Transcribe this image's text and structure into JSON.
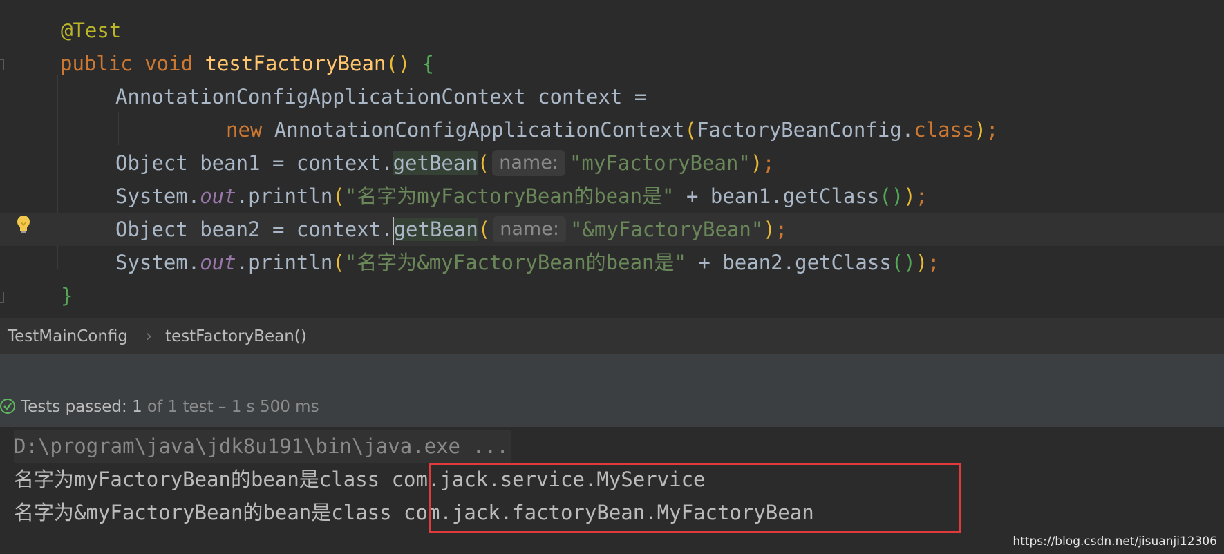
{
  "editor": {
    "annotation": "@Test",
    "method_kw": "public void ",
    "method_name": "testFactoryBean",
    "method_parens": "()",
    "open_brace": " {",
    "line3": "AnnotationConfigApplicationContext context =",
    "line4_kw": "new ",
    "line4_type": "AnnotationConfigApplicationContext",
    "line4_paren_open": "(",
    "line4_arg": "FactoryBeanConfig.",
    "line4_class": "class",
    "line4_paren_close": ")",
    "line4_semi": ";",
    "line5_pre": "Object bean1 = context.",
    "getbean": "getBean",
    "paren_open": "(",
    "hint_label": "name:",
    "line5_str": "\"myFactoryBean\"",
    "paren_close": ")",
    "semi": ";",
    "sys": "System.",
    "out": "out",
    "println": ".println",
    "line6_str": "\"名字为myFactoryBean的bean是\"",
    "line6_rest": " + bean1.getClass",
    "inner_parens": "()",
    "line7_pre": "Object bean2 = context.",
    "line7_str": "\"&myFactoryBean\"",
    "line8_str": "\"名字为&myFactoryBean的bean是\"",
    "line8_rest": " + bean2.getClass",
    "close_brace": "}"
  },
  "breadcrumb": {
    "class": "TestMainConfig",
    "separator": "›",
    "method": "testFactoryBean()"
  },
  "status": {
    "prefix": "Tests passed: ",
    "count": "1",
    "of": " of 1 test",
    "duration": " – 1 s 500 ms"
  },
  "console": {
    "cmd": "D:\\program\\java\\jdk8u191\\bin\\java.exe ...",
    "out1": "名字为myFactoryBean的bean是class com.jack.service.MyService",
    "out2": "名字为&myFactoryBean的bean是class com.jack.factoryBean.MyFactoryBean"
  },
  "watermark": "https://blog.csdn.net/jisuanji12306",
  "colors": {
    "background": "#2b2b2b",
    "keyword": "#cc7832",
    "string": "#6a8759",
    "method": "#ffc66d",
    "annotation": "#bbb529",
    "pass": "#5fb760",
    "highlight_box": "#e03a3a"
  }
}
